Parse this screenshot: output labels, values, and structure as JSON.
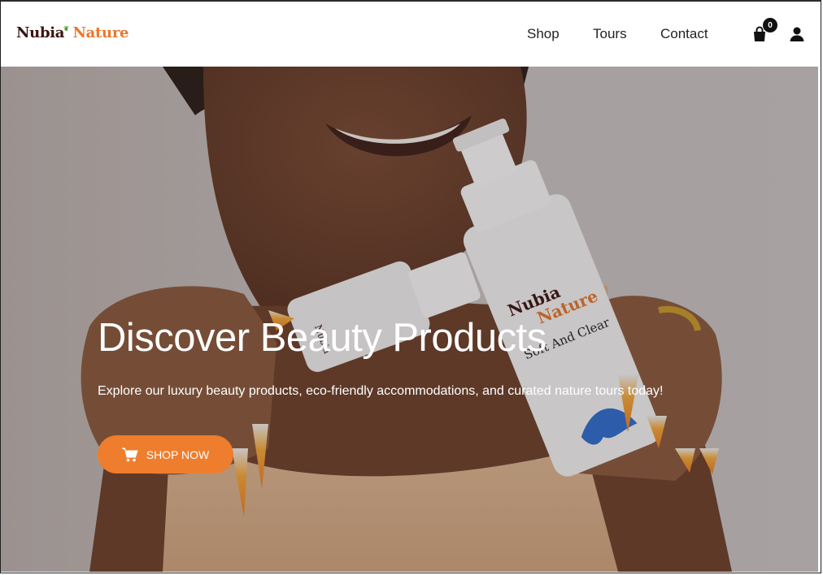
{
  "brand": {
    "name_part1": "Nubia",
    "name_part2": "Nature"
  },
  "nav": {
    "items": [
      {
        "label": "Shop"
      },
      {
        "label": "Tours"
      },
      {
        "label": "Contact"
      }
    ],
    "cart_count": "0",
    "cart_icon": "shopping-bag-icon",
    "user_icon": "user-icon"
  },
  "hero": {
    "title": "Discover Beauty Products",
    "subtitle": "Explore our luxury beauty products, eco-friendly accommodations, and curated nature tours today!",
    "cta_label": "SHOP NOW",
    "cta_icon": "cart-icon",
    "product_label_1": "Nubia",
    "product_label_2": "Nature",
    "product_label_3": "Soft And Clear"
  },
  "colors": {
    "accent": "#ef7d2e",
    "brand_dark": "#3a1410",
    "text_dark": "#222222"
  }
}
